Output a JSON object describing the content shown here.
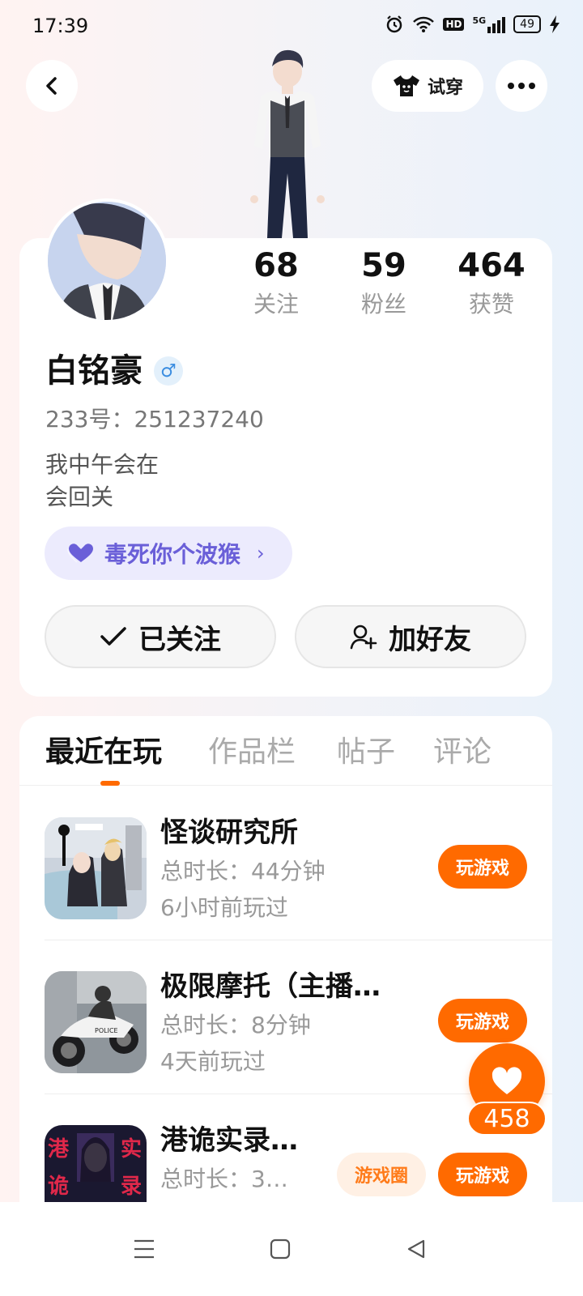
{
  "status_bar": {
    "time": "17:39",
    "network": "5G",
    "hd_label": "HD",
    "battery": "49",
    "icons": [
      "alarm-icon",
      "wifi-icon",
      "hd-icon",
      "signal-icon",
      "battery-icon",
      "charging-icon"
    ]
  },
  "header": {
    "back_icon": "back-icon",
    "tryon_label": "试穿",
    "tryon_icon": "shirt-icon",
    "more_icon": "more-icon"
  },
  "profile": {
    "stats": [
      {
        "value": "68",
        "label": "关注"
      },
      {
        "value": "59",
        "label": "粉丝"
      },
      {
        "value": "464",
        "label": "获赞"
      }
    ],
    "name": "白铭豪",
    "gender_symbol": "♂",
    "account_id": "233号：251237240",
    "bio": "我中午会在\n会回关",
    "tag": {
      "label": "毒死你个波猴",
      "icon": "heart-icon"
    },
    "followed_label": "已关注",
    "add_friend_label": "加好友"
  },
  "tabs": [
    {
      "label": "最近在玩",
      "active": true
    },
    {
      "label": "作品栏",
      "active": false
    },
    {
      "label": "帖子",
      "active": false
    },
    {
      "label": "评论",
      "active": false
    }
  ],
  "games": [
    {
      "title": "怪谈研究所",
      "duration": "总时长：44分钟",
      "last_played": "6小时前玩过",
      "play_label": "玩游戏"
    },
    {
      "title": "极限摩托（主播…",
      "duration": "总时长：8分钟",
      "last_played": "4天前玩过",
      "play_label": "玩游戏"
    },
    {
      "title": "港诡实录…",
      "duration": "总时长：3…",
      "last_played": "",
      "play_label": "玩游戏",
      "circle_label": "游戏圈"
    }
  ],
  "game_icon_text": {
    "ghost_game_top": "港",
    "ghost_game_right": "实",
    "ghost_game_bottom": "诡",
    "ghost_game_br": "录",
    "moto_brand": "POLICE"
  },
  "float_like": {
    "count": "458",
    "icon": "heart-icon"
  },
  "colors": {
    "accent": "#ff6a00",
    "tag_purple": "#6a5fd8",
    "gender_blue": "#3b8de0"
  }
}
